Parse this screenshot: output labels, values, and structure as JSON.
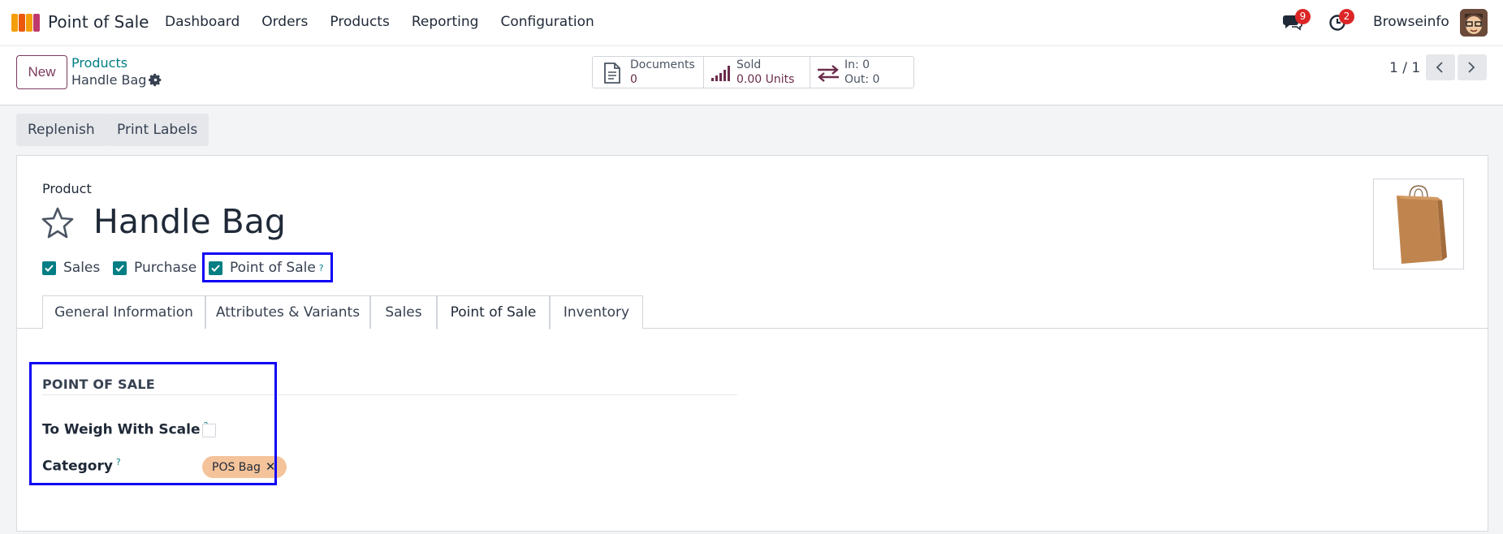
{
  "navbar": {
    "app_title": "Point of Sale",
    "menu": [
      "Dashboard",
      "Orders",
      "Products",
      "Reporting",
      "Configuration"
    ],
    "messages_badge": "9",
    "activities_badge": "2",
    "company": "Browseinfo"
  },
  "control": {
    "new_label": "New",
    "breadcrumb_parent": "Products",
    "breadcrumb_current": "Handle Bag",
    "stats": {
      "documents_label": "Documents",
      "documents_value": "0",
      "sold_label": "Sold",
      "sold_value": "0.00 Units",
      "in_label": "In: 0",
      "out_label": "Out: 0"
    },
    "pager": "1 / 1"
  },
  "actions": {
    "replenish": "Replenish",
    "print_labels": "Print Labels"
  },
  "form": {
    "product_label": "Product",
    "product_name": "Handle Bag",
    "checkboxes": {
      "sales": "Sales",
      "purchase": "Purchase",
      "pos": "Point of Sale",
      "pos_help": "?"
    },
    "tabs": [
      "General Information",
      "Attributes & Variants",
      "Sales",
      "Point of Sale",
      "Inventory"
    ],
    "active_tab": "Point of Sale",
    "section_title": "POINT OF SALE",
    "weigh_label": "To Weigh With Scale",
    "weigh_help": "?",
    "category_label": "Category",
    "category_help": "?",
    "category_tag": "POS Bag"
  },
  "colors": {
    "brand": "#7c3a5e",
    "teal": "#017e84",
    "highlight": "#1000f5",
    "tag": "#f4c39a"
  }
}
